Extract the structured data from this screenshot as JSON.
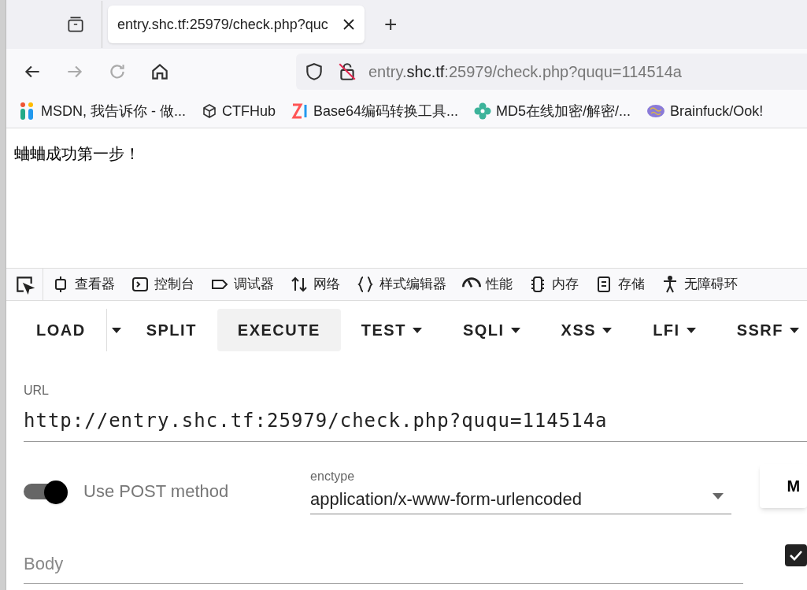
{
  "browser": {
    "tabs": [
      {
        "title": "entry.shc.tf:25979/check.php?quc",
        "selected": true
      }
    ],
    "address": {
      "prefix": "entry.",
      "domain": "shc.tf",
      "rest": ":25979/check.php?ququ=114514a"
    },
    "new_tab": "+",
    "bookmarks": [
      "MSDN, 我告诉你 - 做...",
      "CTFHub",
      "Base64编码转换工具...",
      "MD5在线加密/解密/...",
      "Brainfuck/Ook!"
    ]
  },
  "page": {
    "text": "蛐蛐成功第一步！"
  },
  "devtools": {
    "tabs": [
      {
        "label": "查看器"
      },
      {
        "label": "控制台"
      },
      {
        "label": "调试器"
      },
      {
        "label": "网络"
      },
      {
        "label": "样式编辑器"
      },
      {
        "label": "性能"
      },
      {
        "label": "内存"
      },
      {
        "label": "存储"
      },
      {
        "label": "无障碍环"
      }
    ]
  },
  "hackbar": {
    "buttons": [
      {
        "label": "LOAD",
        "menu": false,
        "selected": false
      },
      {
        "label": "SPLIT",
        "menu": false,
        "selected": false
      },
      {
        "label": "EXECUTE",
        "menu": false,
        "selected": true
      },
      {
        "label": "TEST",
        "menu": true,
        "selected": false
      },
      {
        "label": "SQLI",
        "menu": true,
        "selected": false
      },
      {
        "label": "XSS",
        "menu": true,
        "selected": false
      },
      {
        "label": "LFI",
        "menu": true,
        "selected": false
      },
      {
        "label": "SSRF",
        "menu": true,
        "selected": false
      }
    ],
    "url_label": "URL",
    "url": "http://entry.shc.tf:25979/check.php?ququ=114514a",
    "post": {
      "label": "Use POST method",
      "on": true
    },
    "enctype": {
      "label": "enctype",
      "value": "application/x-www-form-urlencoded"
    },
    "side_button": "M",
    "body_placeholder": "Body",
    "checkbox": {
      "checked": true
    }
  }
}
